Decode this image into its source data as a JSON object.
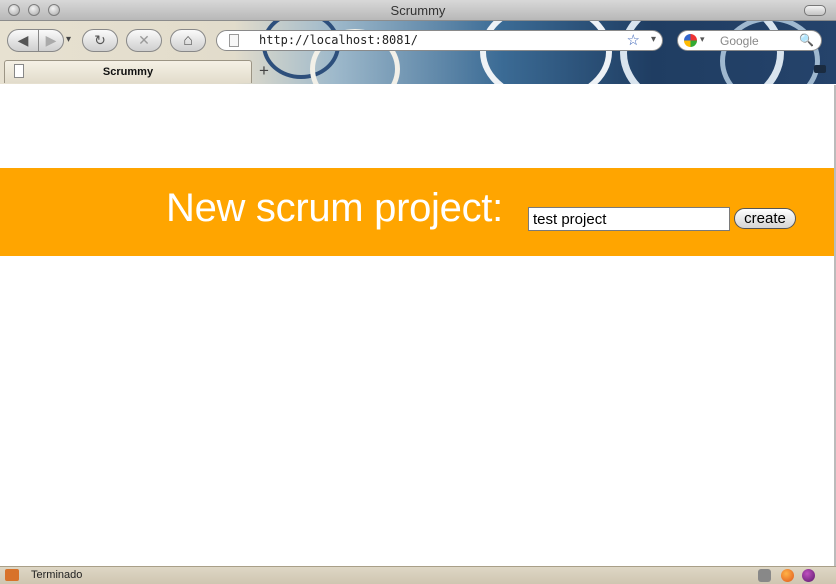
{
  "window": {
    "title": "Scrummy"
  },
  "toolbar": {
    "back_glyph": "◀",
    "forward_glyph": "▶",
    "dropdown_glyph": "▾",
    "reload_glyph": "↻",
    "stop_glyph": "✕",
    "home_glyph": "⌂",
    "url": "http://localhost:8081/",
    "star_glyph": "☆",
    "search_placeholder": "Google",
    "search_glyph": "🔍"
  },
  "tabs": [
    {
      "label": "Scrummy"
    }
  ],
  "new_tab_glyph": "+",
  "page": {
    "heading": "New scrum project:",
    "input_value": "test project",
    "button_label": "create",
    "banner_color": "#ffa500"
  },
  "status": {
    "text": "Terminado"
  },
  "icons": [
    "back-icon",
    "forward-icon",
    "reload-icon",
    "stop-icon",
    "home-icon",
    "bookmark-star-icon",
    "search-icon",
    "page-icon",
    "firefox-icon",
    "bug-icon"
  ]
}
